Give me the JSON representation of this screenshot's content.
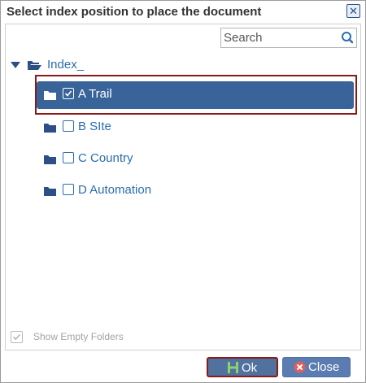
{
  "dialog": {
    "title": "Select index position to place the document",
    "close_icon": "close-x-icon"
  },
  "search": {
    "placeholder": "Search",
    "value": "",
    "icon": "search-icon"
  },
  "tree": {
    "root": {
      "label": "Index_",
      "expanded": true,
      "icon": "folder-open-icon"
    },
    "nodes": [
      {
        "label": "A Trail",
        "checked": true,
        "selected": true,
        "icon": "folder-icon"
      },
      {
        "label": "B SIte",
        "checked": false,
        "selected": false,
        "icon": "folder-icon"
      },
      {
        "label": "C Country",
        "checked": false,
        "selected": false,
        "icon": "folder-icon"
      },
      {
        "label": "D Automation",
        "checked": false,
        "selected": false,
        "icon": "folder-icon"
      }
    ]
  },
  "options": {
    "show_empty_folders_label": "Show Empty Folders",
    "show_empty_folders_checked": true
  },
  "buttons": {
    "ok_label": "Ok",
    "close_label": "Close"
  },
  "colors": {
    "selected_bg": "#386499",
    "link_text": "#2a6db0",
    "highlight_border": "#8b1a1a",
    "button_bg": "#51719f"
  }
}
